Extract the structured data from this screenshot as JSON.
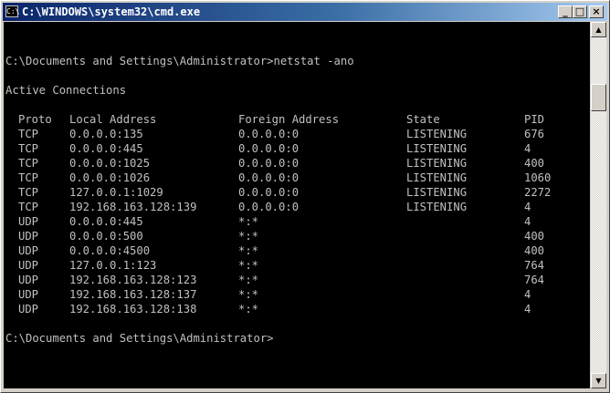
{
  "window": {
    "title": "C:\\WINDOWS\\system32\\cmd.exe",
    "icon_label": "C:\\",
    "buttons": {
      "minimize": "_",
      "maximize": "□",
      "close": "×"
    }
  },
  "console": {
    "command_line": "C:\\Documents and Settings\\Administrator>netstat -ano",
    "section_title": "Active Connections",
    "columns": [
      "Proto",
      "Local Address",
      "Foreign Address",
      "State",
      "PID"
    ],
    "rows": [
      [
        "TCP",
        "0.0.0.0:135",
        "0.0.0.0:0",
        "LISTENING",
        "676"
      ],
      [
        "TCP",
        "0.0.0.0:445",
        "0.0.0.0:0",
        "LISTENING",
        "4"
      ],
      [
        "TCP",
        "0.0.0.0:1025",
        "0.0.0.0:0",
        "LISTENING",
        "400"
      ],
      [
        "TCP",
        "0.0.0.0:1026",
        "0.0.0.0:0",
        "LISTENING",
        "1060"
      ],
      [
        "TCP",
        "127.0.0.1:1029",
        "0.0.0.0:0",
        "LISTENING",
        "2272"
      ],
      [
        "TCP",
        "192.168.163.128:139",
        "0.0.0.0:0",
        "LISTENING",
        "4"
      ],
      [
        "UDP",
        "0.0.0.0:445",
        "*:*",
        "",
        "4"
      ],
      [
        "UDP",
        "0.0.0.0:500",
        "*:*",
        "",
        "400"
      ],
      [
        "UDP",
        "0.0.0.0:4500",
        "*:*",
        "",
        "400"
      ],
      [
        "UDP",
        "127.0.0.1:123",
        "*:*",
        "",
        "764"
      ],
      [
        "UDP",
        "192.168.163.128:123",
        "*:*",
        "",
        "764"
      ],
      [
        "UDP",
        "192.168.163.128:137",
        "*:*",
        "",
        "4"
      ],
      [
        "UDP",
        "192.168.163.128:138",
        "*:*",
        "",
        "4"
      ]
    ],
    "prompt": "C:\\Documents and Settings\\Administrator>"
  },
  "scrollbar": {
    "up_arrow": "▲",
    "down_arrow": "▼"
  },
  "colors": {
    "console_bg": "#000000",
    "console_text": "#c0c0c0",
    "titlebar_start": "#0a246a",
    "titlebar_end": "#a6caf0"
  }
}
